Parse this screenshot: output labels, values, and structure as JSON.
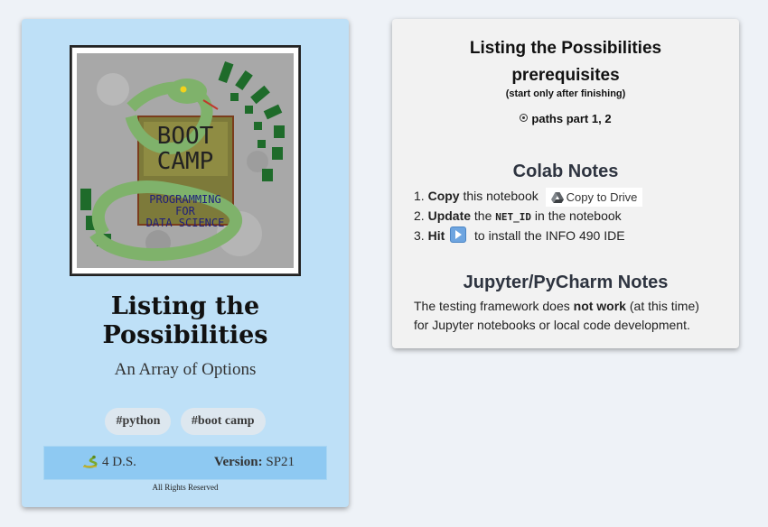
{
  "book": {
    "cover_text": [
      "BOOT",
      "CAMP",
      "PROGRAMMING",
      "FOR",
      "DATA SCIENCE"
    ],
    "title_line1": "Listing the",
    "title_line2": "Possibilities",
    "subtitle": "An Array of Options",
    "tags": [
      "#python",
      "#boot camp"
    ],
    "publisher": "4 D.S.",
    "version_label": "Version:",
    "version_value": "SP21",
    "rights": "All Rights Reserved"
  },
  "panel": {
    "title_line1": "Listing the Possibilities",
    "title_line2": "prerequisites",
    "note": "(start only after finishing)",
    "prereq": "paths part 1, 2",
    "colab_heading": "Colab Notes",
    "steps": [
      {
        "num": "1.",
        "bold": "Copy",
        "text": "this notebook",
        "button": "Copy to Drive"
      },
      {
        "num": "2.",
        "bold": "Update",
        "pre": "the",
        "code": "NET_ID",
        "post": "in the notebook"
      },
      {
        "num": "3.",
        "bold": "Hit",
        "post": "to install the INFO 490 IDE"
      }
    ],
    "jupyter_heading": "Jupyter/PyCharm Notes",
    "jupyter_line1_a": "The testing framework does",
    "jupyter_line1_bold": "not work",
    "jupyter_line1_b": "(at this time)",
    "jupyter_line2": "for Jupyter notebooks or local code development."
  },
  "colors": {
    "background": "#eef2f7",
    "book_card": "#bee0f7",
    "info_bar": "#8ec9f2",
    "panel": "#f2f2f2"
  }
}
